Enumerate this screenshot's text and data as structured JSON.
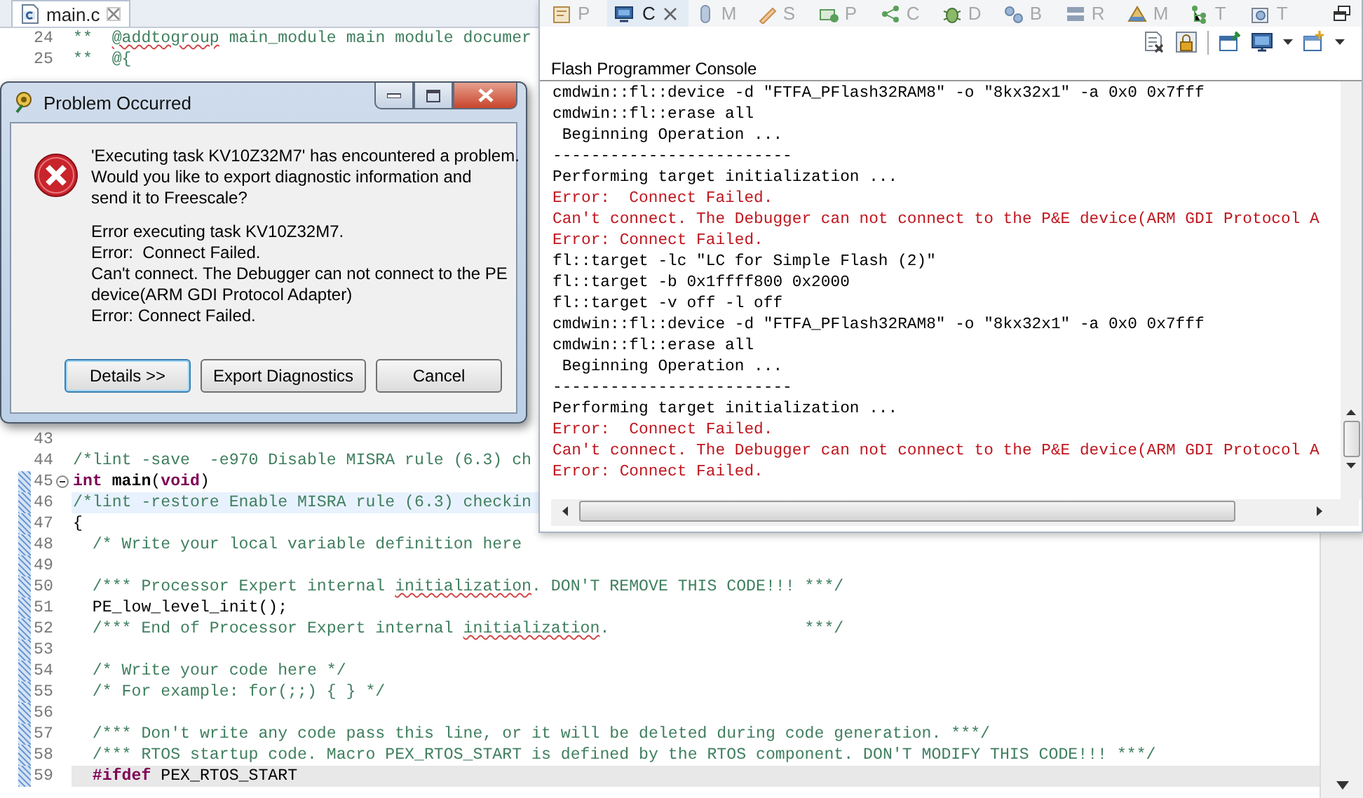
{
  "editor": {
    "tab": {
      "label": "main.c",
      "selected": true
    },
    "lines_top": [
      {
        "number": "24",
        "changed": false,
        "fold": false,
        "segments": [
          {
            "kind": "comment",
            "text": "**  "
          },
          {
            "kind": "misspelled",
            "text": "@addtogroup"
          },
          {
            "kind": "comment",
            "text": " main_module main module documer"
          }
        ]
      },
      {
        "number": "25",
        "changed": false,
        "fold": false,
        "segments": [
          {
            "kind": "comment",
            "text": "**  @{"
          }
        ]
      }
    ],
    "lines_bottom": [
      {
        "number": "43",
        "kind": "plain",
        "changed": false,
        "fold": false
      },
      {
        "number": "44",
        "kind": "plain",
        "changed": false,
        "fold": false,
        "segments": [
          {
            "kind": "comment",
            "text": "/*lint -save  -e970 Disable MISRA rule (6.3) ch"
          }
        ]
      },
      {
        "number": "45",
        "kind": "plain",
        "changed": true,
        "fold": true,
        "segments": [
          {
            "kind": "keyword",
            "text": "int"
          },
          {
            "kind": "function",
            "text": " main"
          },
          {
            "kind": "plain",
            "text": "("
          },
          {
            "kind": "keyword",
            "text": "void"
          },
          {
            "kind": "plain",
            "text": ")"
          }
        ]
      },
      {
        "number": "46",
        "kind": "marked",
        "changed": true,
        "fold": false,
        "segments": [
          {
            "kind": "comment",
            "text": "/*lint -restore Enable MISRA rule (6.3) checkin"
          }
        ]
      },
      {
        "number": "47",
        "kind": "plain",
        "changed": true,
        "fold": false,
        "segments": [
          {
            "kind": "plain",
            "text": "{"
          }
        ]
      },
      {
        "number": "48",
        "kind": "plain",
        "changed": true,
        "fold": false,
        "segments": [
          {
            "kind": "comment",
            "text": "  /* Write your local variable definition here"
          }
        ]
      },
      {
        "number": "49",
        "kind": "plain",
        "changed": true,
        "fold": false
      },
      {
        "number": "50",
        "kind": "plain",
        "changed": true,
        "fold": false,
        "segments": [
          {
            "kind": "comment",
            "text": "  /*** Processor Expert internal "
          },
          {
            "kind": "misspelled",
            "text": "initialization"
          },
          {
            "kind": "comment",
            "text": ". DON'T REMOVE THIS CODE!!! ***/"
          }
        ]
      },
      {
        "number": "51",
        "kind": "plain",
        "changed": true,
        "fold": false,
        "segments": [
          {
            "kind": "plain",
            "text": "  PE_low_level_init();"
          }
        ]
      },
      {
        "number": "52",
        "kind": "plain",
        "changed": true,
        "fold": false,
        "segments": [
          {
            "kind": "comment",
            "text": "  /*** End of Processor Expert internal "
          },
          {
            "kind": "misspelled",
            "text": "initialization"
          },
          {
            "kind": "comment",
            "text": ".                    ***/"
          }
        ]
      },
      {
        "number": "53",
        "kind": "plain",
        "changed": true,
        "fold": false
      },
      {
        "number": "54",
        "kind": "plain",
        "changed": true,
        "fold": false,
        "segments": [
          {
            "kind": "comment",
            "text": "  /* Write your code here */"
          }
        ]
      },
      {
        "number": "55",
        "kind": "plain",
        "changed": true,
        "fold": false,
        "segments": [
          {
            "kind": "comment",
            "text": "  /* For example: for(;;) { } */"
          }
        ]
      },
      {
        "number": "56",
        "kind": "plain",
        "changed": true,
        "fold": false
      },
      {
        "number": "57",
        "kind": "plain",
        "changed": true,
        "fold": false,
        "segments": [
          {
            "kind": "comment",
            "text": "  /*** Don't write any code pass this line, or it will be deleted during code generation. ***/"
          }
        ]
      },
      {
        "number": "58",
        "kind": "plain",
        "changed": true,
        "fold": false,
        "segments": [
          {
            "kind": "comment",
            "text": "  /*** RTOS startup code. Macro PEX_RTOS_START is defined by the RTOS component. DON'T MODIFY THIS CODE!!! ***/"
          }
        ]
      },
      {
        "number": "59",
        "kind": "current",
        "changed": true,
        "fold": false,
        "segments": [
          {
            "kind": "preproc",
            "text": "  #ifdef"
          },
          {
            "kind": "plain",
            "text": " PEX_RTOS_START"
          }
        ]
      }
    ]
  },
  "console_view": {
    "tabs": [
      {
        "label": "P",
        "selected": false
      },
      {
        "label": "C",
        "selected": true
      },
      {
        "label": "M",
        "selected": false
      },
      {
        "label": "S",
        "selected": false
      },
      {
        "label": "P",
        "selected": false
      },
      {
        "label": "C",
        "selected": false
      },
      {
        "label": "D",
        "selected": false
      },
      {
        "label": "B",
        "selected": false
      },
      {
        "label": "R",
        "selected": false
      },
      {
        "label": "M",
        "selected": false
      },
      {
        "label": "T",
        "selected": false
      },
      {
        "label": "T",
        "selected": false
      }
    ],
    "title": "Flash Programmer Console",
    "lines": [
      {
        "kind": "output",
        "text": "cmdwin::fl::device -d \"FTFA_PFlash32RAM8\" -o \"8kx32x1\" -a 0x0 0x7fff"
      },
      {
        "kind": "output",
        "text": "cmdwin::fl::erase all"
      },
      {
        "kind": "output",
        "text": " Beginning Operation ..."
      },
      {
        "kind": "output",
        "text": "-------------------------"
      },
      {
        "kind": "output",
        "text": "Performing target initialization ..."
      },
      {
        "kind": "error",
        "text": "Error:  Connect Failed."
      },
      {
        "kind": "error",
        "text": "Can't connect. The Debugger can not connect to the P&E device(ARM GDI Protocol A"
      },
      {
        "kind": "error",
        "text": "Error: Connect Failed."
      },
      {
        "kind": "output",
        "text": "fl::target -lc \"LC for Simple Flash (2)\""
      },
      {
        "kind": "output",
        "text": "fl::target -b 0x1ffff800 0x2000"
      },
      {
        "kind": "output",
        "text": "fl::target -v off -l off"
      },
      {
        "kind": "output",
        "text": "cmdwin::fl::device -d \"FTFA_PFlash32RAM8\" -o \"8kx32x1\" -a 0x0 0x7fff"
      },
      {
        "kind": "output",
        "text": "cmdwin::fl::erase all"
      },
      {
        "kind": "output",
        "text": " Beginning Operation ..."
      },
      {
        "kind": "output",
        "text": "-------------------------"
      },
      {
        "kind": "output",
        "text": "Performing target initialization ..."
      },
      {
        "kind": "error",
        "text": "Error:  Connect Failed."
      },
      {
        "kind": "error",
        "text": "Can't connect. The Debugger can not connect to the P&E device(ARM GDI Protocol A"
      },
      {
        "kind": "error",
        "text": "Error: Connect Failed."
      }
    ]
  },
  "dialog": {
    "title": "Problem Occurred",
    "message": "'Executing task KV10Z32M7' has encountered a problem.\nWould you like to export diagnostic information and\nsend it to Freescale?",
    "details": "Error executing task KV10Z32M7.\nError:  Connect Failed.\nCan't connect. The Debugger can not connect to the PE\ndevice(ARM GDI Protocol Adapter)\nError: Connect Failed.",
    "buttons": [
      {
        "label": "Details >>",
        "default": true
      },
      {
        "label": "Export Diagnostics",
        "default": false
      },
      {
        "label": "Cancel",
        "default": false
      }
    ]
  }
}
